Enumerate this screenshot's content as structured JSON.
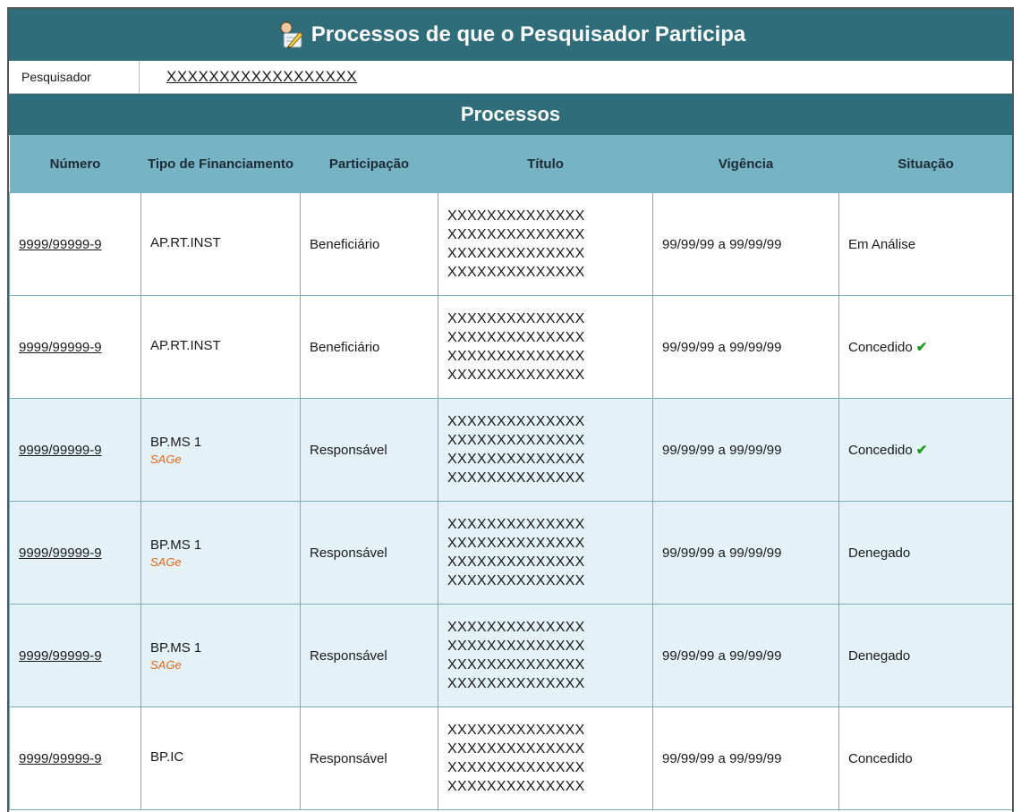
{
  "header": {
    "title": "Processos de que o Pesquisador Participa",
    "icon": "researcher-edit-icon"
  },
  "researcher": {
    "label": "Pesquisador",
    "value": "XXXXXXXXXXXXXXXXXX"
  },
  "section": {
    "title": "Processos"
  },
  "table": {
    "columns": [
      "Número",
      "Tipo de Financiamento",
      "Participação",
      "Título",
      "Vigência",
      "Situação"
    ],
    "rows": [
      {
        "numero": "9999/99999-9",
        "tipo": "AP.RT.INST",
        "sage": "",
        "participacao": "Beneficiário",
        "titulo": [
          "XXXXXXXXXXXXXX",
          "XXXXXXXXXXXXXX",
          "XXXXXXXXXXXXXX",
          "XXXXXXXXXXXXXX"
        ],
        "vigencia": "99/99/99 a 99/99/99",
        "situacao": "Em Análise",
        "check": ""
      },
      {
        "numero": "9999/99999-9",
        "tipo": "AP.RT.INST",
        "sage": "",
        "participacao": "Beneficiário",
        "titulo": [
          "XXXXXXXXXXXXXX",
          "XXXXXXXXXXXXXX",
          "XXXXXXXXXXXXXX",
          "XXXXXXXXXXXXXX"
        ],
        "vigencia": "99/99/99 a 99/99/99",
        "situacao": "Concedido",
        "check": "✔"
      },
      {
        "numero": "9999/99999-9",
        "tipo": "BP.MS  1",
        "sage": "SAGe",
        "participacao": "Responsável",
        "titulo": [
          "XXXXXXXXXXXXXX",
          "XXXXXXXXXXXXXX",
          "XXXXXXXXXXXXXX",
          "XXXXXXXXXXXXXX"
        ],
        "vigencia": "99/99/99 a 99/99/99",
        "situacao": "Concedido",
        "check": "✔"
      },
      {
        "numero": "9999/99999-9",
        "tipo": "BP.MS  1",
        "sage": "SAGe",
        "participacao": "Responsável",
        "titulo": [
          "XXXXXXXXXXXXXX",
          "XXXXXXXXXXXXXX",
          "XXXXXXXXXXXXXX",
          "XXXXXXXXXXXXXX"
        ],
        "vigencia": "99/99/99 a 99/99/99",
        "situacao": "Denegado",
        "check": ""
      },
      {
        "numero": "9999/99999-9",
        "tipo": "BP.MS  1",
        "sage": "SAGe",
        "participacao": "Responsável",
        "titulo": [
          "XXXXXXXXXXXXXX",
          "XXXXXXXXXXXXXX",
          "XXXXXXXXXXXXXX",
          "XXXXXXXXXXXXXX"
        ],
        "vigencia": "99/99/99 a 99/99/99",
        "situacao": "Denegado",
        "check": ""
      },
      {
        "numero": "9999/99999-9",
        "tipo": "BP.IC",
        "sage": "",
        "participacao": "Responsável",
        "titulo": [
          "XXXXXXXXXXXXXX",
          "XXXXXXXXXXXXXX",
          "XXXXXXXXXXXXXX",
          "XXXXXXXXXXXXXX"
        ],
        "vigencia": "99/99/99 a 99/99/99",
        "situacao": "Concedido",
        "check": ""
      }
    ]
  },
  "colors": {
    "header_bg": "#2f6d7a",
    "column_header_bg": "#75b3c5",
    "alt_row_bg": "#e4f1f6",
    "sage_text": "#e0691c",
    "check": "#1a9a1a"
  }
}
